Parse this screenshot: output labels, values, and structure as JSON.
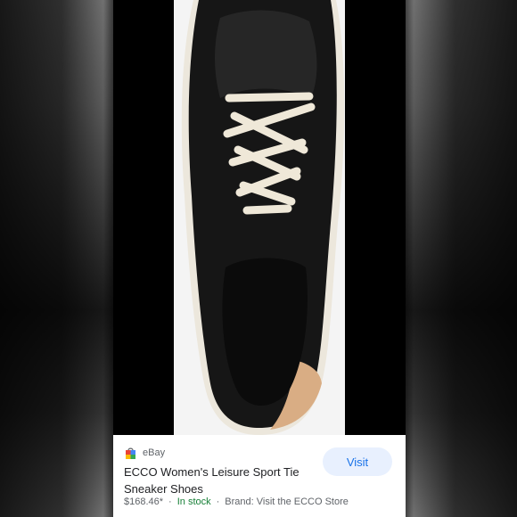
{
  "listing": {
    "source": "eBay",
    "title": "ECCO Women's Leisure Sport Tie Sneaker Shoes",
    "price": "$168.46*",
    "stock_status": "In stock",
    "brand_text": "Brand: Visit the ECCO Store",
    "visit_label": "Visit"
  },
  "colors": {
    "shoe": "#161616",
    "laces": "#efe8d8",
    "heel_tab": "#d9ad84",
    "stock_green": "#188038",
    "visit_bg": "#e8f0fe",
    "visit_text": "#1a73e8"
  },
  "icons": {
    "source": "shopping-bag-icon"
  }
}
